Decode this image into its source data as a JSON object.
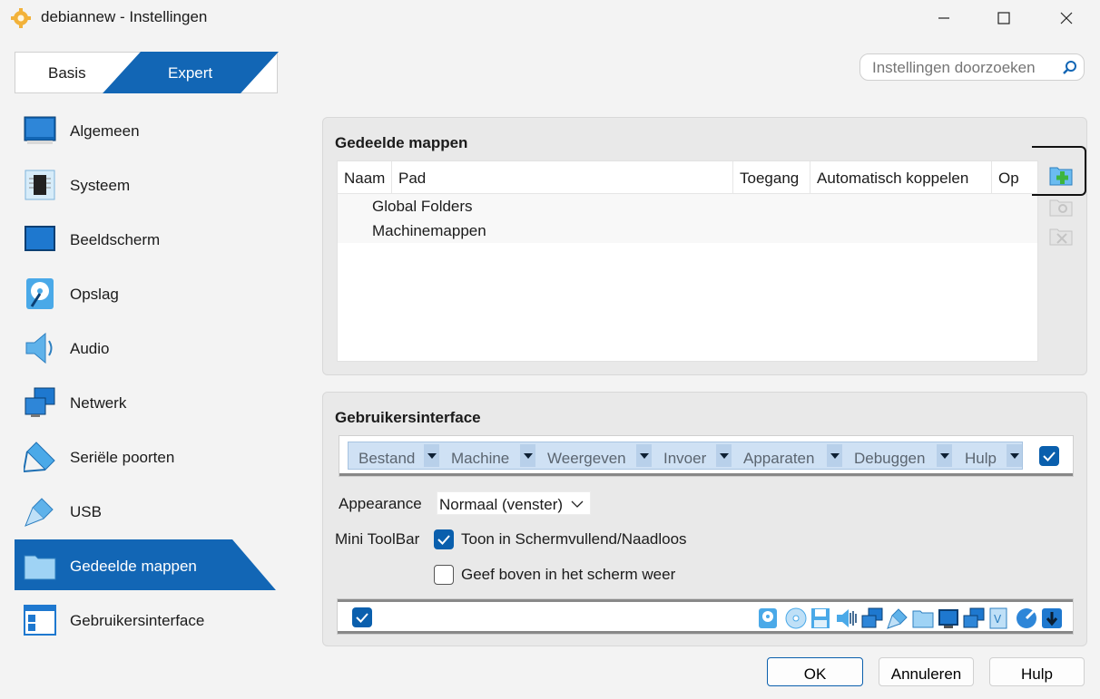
{
  "window": {
    "title": "debiannew - Instellingen",
    "icon": "gear-icon"
  },
  "mode": {
    "basis_label": "Basis",
    "expert_label": "Expert",
    "selected": "Expert"
  },
  "search": {
    "placeholder": "Instellingen doorzoeken"
  },
  "sidebar": {
    "items": [
      {
        "label": "Algemeen",
        "icon": "monitor-icon"
      },
      {
        "label": "Systeem",
        "icon": "chip-icon"
      },
      {
        "label": "Beeldscherm",
        "icon": "display-icon"
      },
      {
        "label": "Opslag",
        "icon": "disk-icon"
      },
      {
        "label": "Audio",
        "icon": "speaker-icon"
      },
      {
        "label": "Netwerk",
        "icon": "network-icon"
      },
      {
        "label": "Seriële poorten",
        "icon": "serial-port-icon"
      },
      {
        "label": "USB",
        "icon": "usb-icon"
      },
      {
        "label": "Gedeelde mappen",
        "icon": "shared-folder-icon",
        "active": true
      },
      {
        "label": "Gebruikersinterface",
        "icon": "user-interface-icon"
      }
    ]
  },
  "shared_folders": {
    "title": "Gedeelde mappen",
    "columns": [
      "Naam",
      "Pad",
      "Toegang",
      "Automatisch koppelen",
      "Op"
    ],
    "rows": [
      "Global Folders",
      "Machinemappen"
    ],
    "tools": [
      "add-shared-folder-icon",
      "edit-shared-folder-icon",
      "remove-shared-folder-icon"
    ]
  },
  "user_interface": {
    "title": "Gebruikersinterface",
    "menu_items": [
      "Bestand",
      "Machine",
      "Weergeven",
      "Invoer",
      "Apparaten",
      "Debuggen",
      "Hulp"
    ],
    "appearance_label": "Appearance",
    "appearance_value": "Normaal (venster)",
    "mini_toolbar_label": "Mini ToolBar",
    "option_show_fullscreen": "Toon in Schermvullend/Naadloos",
    "option_show_fullscreen_checked": true,
    "option_top_of_screen": "Geef boven in het scherm weer",
    "option_top_of_screen_checked": false,
    "statusbar_icons": [
      "hard-disk-icon",
      "optical-disk-icon",
      "floppy-icon",
      "audio-icon",
      "network-icon",
      "usb-icon",
      "shared-folder-icon",
      "display-icon",
      "recording-icon",
      "virtualization-icon",
      "mouse-integration-icon",
      "keyboard-host-icon"
    ]
  },
  "buttons": {
    "ok": "OK",
    "cancel": "Annuleren",
    "help": "Hulp"
  },
  "colors": {
    "accent": "#1266b5",
    "checkbox": "#0a5fad"
  }
}
